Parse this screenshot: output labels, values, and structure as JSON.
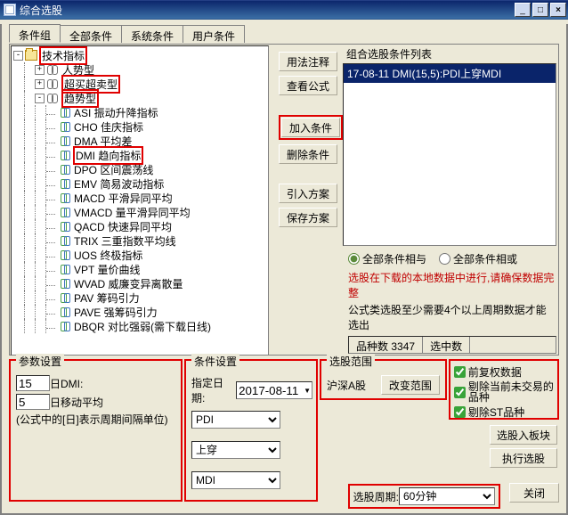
{
  "window": {
    "title": "综合选股"
  },
  "tabs": [
    "条件组",
    "全部条件",
    "系统条件",
    "用户条件"
  ],
  "tree": {
    "root": "技术指标",
    "cat1": "人势型",
    "cat2": "超买超卖型",
    "cat3": "趋势型",
    "items": [
      "ASI 振动升降指标",
      "CHO 佳庆指标",
      "DMA 平均差",
      "DMI 趋向指标",
      "DPO 区间震荡线",
      "EMV 简易波动指标",
      "MACD 平滑异同平均",
      "VMACD 量平滑异同平均",
      "QACD 快速异同平均",
      "TRIX 三重指数平均线",
      "UOS 终极指标",
      "VPT 量价曲线",
      "WVAD 威廉变异离散量",
      "PAV 筹码引力",
      "PAVE 强筹码引力",
      "DBQR 对比强弱(需下载日线)"
    ]
  },
  "action_buttons": {
    "usage": "用法注释",
    "view": "查看公式",
    "add": "加入条件",
    "del": "删除条件",
    "import": "引入方案",
    "save": "保存方案"
  },
  "cond_list": {
    "label": "组合选股条件列表",
    "row1": "17-08-11 DMI(15,5):PDI上穿MDI"
  },
  "radios": {
    "r1": "全部条件相与",
    "r2": "全部条件相或"
  },
  "warning": "选股在下载的本地数据中进行,请确保数据完整",
  "info": "公式类选股至少需要4个以上周期数据才能选出",
  "counts": {
    "c1label": "品种数",
    "c1val": "3347",
    "c2label": "选中数"
  },
  "param": {
    "legend": "参数设置",
    "v1": "15",
    "l1": "日DMI:",
    "v2": "5",
    "l2": "日移动平均",
    "note": "(公式中的[日]表示周期间隔单位)"
  },
  "cond": {
    "legend": "条件设置",
    "datelabel": "指定日期:",
    "date": "2017-08-11",
    "s1": "PDI",
    "s2": "上穿",
    "s3": "MDI"
  },
  "scope": {
    "legend": "选股范围",
    "market": "沪深A股",
    "change": "改变范围"
  },
  "checks": {
    "c1": "前复权数据",
    "c2": "剔除当前未交易的品种",
    "c3": "剔除ST品种"
  },
  "btns": {
    "block": "选股入板块",
    "exec": "执行选股",
    "close": "关闭"
  },
  "cycle": {
    "label": "选股周期:",
    "value": "60分钟"
  }
}
